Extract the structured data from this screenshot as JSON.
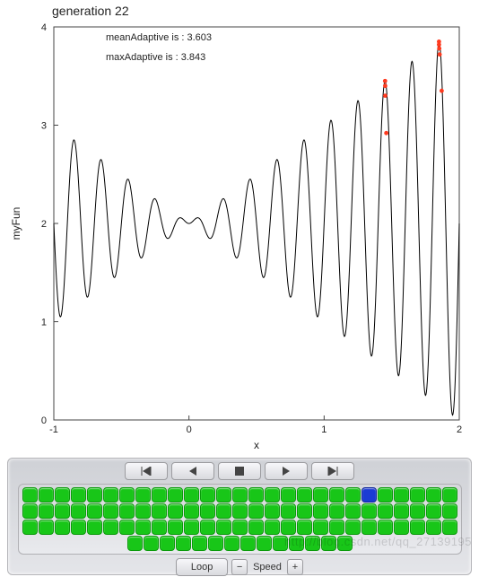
{
  "chart_data": {
    "type": "line",
    "title": "generation 22",
    "xlabel": "x",
    "ylabel": "myFun",
    "xlim": [
      -1,
      2
    ],
    "ylim": [
      0,
      4
    ],
    "xticks": [
      -1,
      0,
      1,
      2
    ],
    "yticks": [
      0,
      1,
      2,
      3,
      4
    ],
    "annotations": [
      "meanAdaptive is :  3.603",
      "maxAdaptive is :  3.843"
    ],
    "series": [
      {
        "name": "myFun",
        "color": "#000000",
        "function": "x * sin(10*pi*x) + 2",
        "x_range": [
          -1,
          2
        ],
        "samples": 900
      }
    ],
    "scatter": {
      "name": "population",
      "color": "#ff3a1f",
      "points": [
        {
          "x": 1.451,
          "y": 3.45
        },
        {
          "x": 1.452,
          "y": 3.4
        },
        {
          "x": 1.452,
          "y": 3.3
        },
        {
          "x": 1.46,
          "y": 2.92
        },
        {
          "x": 1.85,
          "y": 3.85
        },
        {
          "x": 1.85,
          "y": 3.82
        },
        {
          "x": 1.852,
          "y": 3.78
        },
        {
          "x": 1.855,
          "y": 3.72
        },
        {
          "x": 1.87,
          "y": 3.35
        }
      ]
    }
  },
  "controls": {
    "nav": {
      "first": "|←",
      "prev": "←",
      "stop": "■",
      "next": "→",
      "last": "→|"
    },
    "grid": {
      "rows": [
        27,
        27,
        27,
        14
      ],
      "active_index": 21,
      "color_default": "#18c618",
      "color_active": "#1b3bd4"
    },
    "loop_label": "Loop",
    "speed_label": "Speed",
    "minus": "−",
    "plus": "+"
  },
  "watermark": "http://blog.csdn.net/qq_27139195"
}
